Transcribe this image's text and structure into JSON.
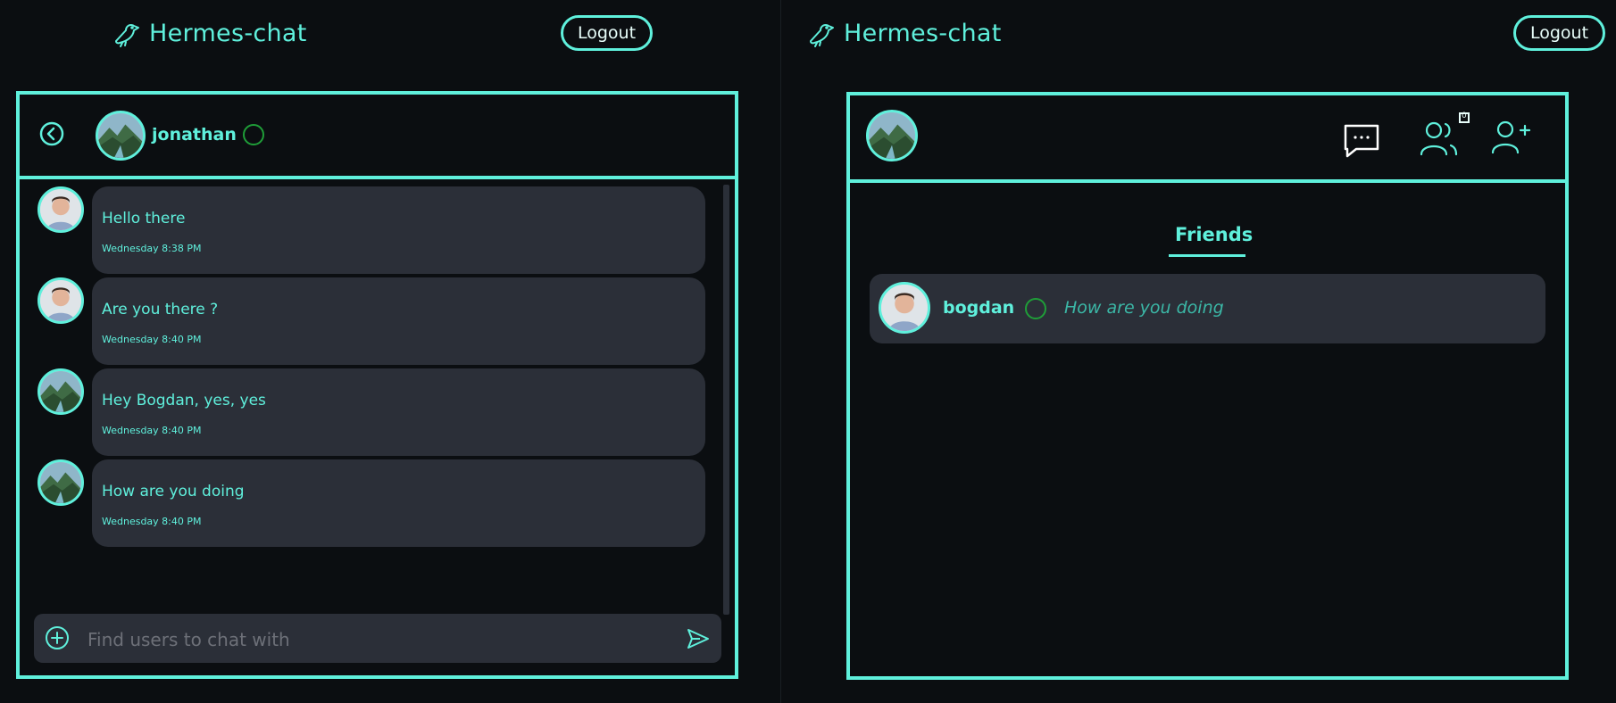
{
  "app": {
    "name": "Hermes-chat",
    "logout_label": "Logout",
    "accent_color": "#5ff0dc",
    "background_color": "#0b0e11",
    "bubble_color": "#2b2f38",
    "online_ring_color": "#1f9e38"
  },
  "chat_view": {
    "contact_name": "jonathan",
    "messages": [
      {
        "sender_avatar": "male-portrait",
        "text": "Hello there",
        "time": "Wednesday 8:38 PM"
      },
      {
        "sender_avatar": "male-portrait",
        "text": "Are you there ?",
        "time": "Wednesday 8:40 PM"
      },
      {
        "sender_avatar": "landscape",
        "text": "Hey Bogdan, yes, yes",
        "time": "Wednesday 8:40 PM"
      },
      {
        "sender_avatar": "landscape",
        "text": "How are you doing",
        "time": "Wednesday 8:40 PM"
      }
    ],
    "composer_placeholder": "Find users to chat with"
  },
  "friends_view": {
    "tab_label": "Friends",
    "icons": [
      "chat-bubble-icon",
      "friends-group-icon",
      "add-user-icon"
    ],
    "friend_requests_badge": "0",
    "friends": [
      {
        "name": "bogdan",
        "last_message": "How are you doing"
      }
    ]
  }
}
